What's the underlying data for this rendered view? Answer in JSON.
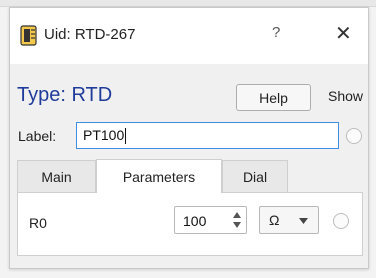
{
  "window": {
    "title": "Uid: RTD-267",
    "help_glyph": "?",
    "close_glyph": "✕",
    "icon": "component-chip-icon"
  },
  "header": {
    "type_label": "Type: RTD",
    "help_button": "Help",
    "show_label": "Show"
  },
  "label_row": {
    "caption": "Label:",
    "value": "PT100"
  },
  "tabs": [
    {
      "label": "Main",
      "active": false
    },
    {
      "label": "Parameters",
      "active": true
    },
    {
      "label": "Dial",
      "active": false
    }
  ],
  "parameters": {
    "rows": [
      {
        "name": "R0",
        "value": "100",
        "unit": "Ω"
      }
    ]
  },
  "colors": {
    "type_label": "#1f3c9a",
    "focus_border": "#3f8ee0"
  }
}
